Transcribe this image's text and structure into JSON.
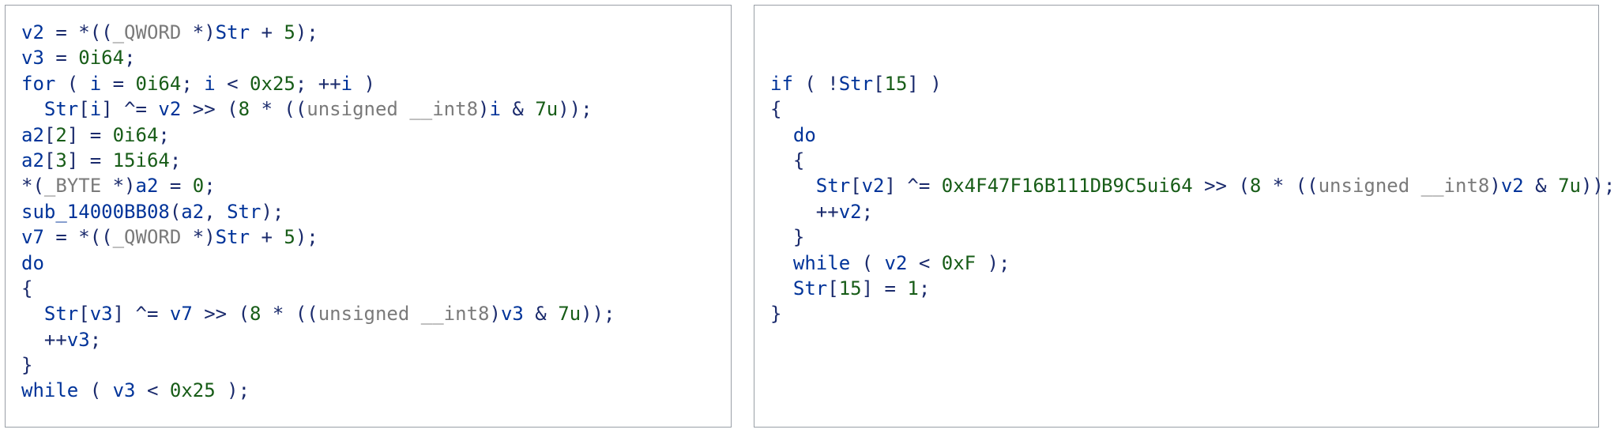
{
  "left": {
    "l1": {
      "a": "v2",
      "b": " = *((",
      "c": "_QWORD",
      "d": " *)",
      "e": "Str",
      "f": " + ",
      "g": "5",
      "h": ");"
    },
    "l2": {
      "a": "v3",
      "b": " = ",
      "c": "0i64",
      "d": ";"
    },
    "l3": {
      "a": "for",
      "b": " ( ",
      "c": "i",
      "d": " = ",
      "e": "0i64",
      "f": "; ",
      "g": "i",
      "h": " < ",
      "i": "0x25",
      "j": "; ++",
      "k": "i",
      "l": " )"
    },
    "l4": {
      "a": "  ",
      "b": "Str",
      "c": "[",
      "d": "i",
      "e": "] ^= ",
      "f": "v2",
      "g": " >> (",
      "h": "8",
      "i": " * ((",
      "j": "unsigned __int8",
      "k": ")",
      "l": "i",
      "m": " & ",
      "n": "7u",
      "o": "));"
    },
    "l5": {
      "a": "a2",
      "b": "[",
      "c": "2",
      "d": "] = ",
      "e": "0i64",
      "f": ";"
    },
    "l6": {
      "a": "a2",
      "b": "[",
      "c": "3",
      "d": "] = ",
      "e": "15i64",
      "f": ";"
    },
    "l7": {
      "a": "*(",
      "b": "_BYTE",
      "c": " *)",
      "d": "a2",
      "e": " = ",
      "f": "0",
      "g": ";"
    },
    "l8": {
      "a": "sub_14000BB08",
      "b": "(",
      "c": "a2",
      "d": ", ",
      "e": "Str",
      "f": ");"
    },
    "l9": {
      "a": "v7",
      "b": " = *((",
      "c": "_QWORD",
      "d": " *)",
      "e": "Str",
      "f": " + ",
      "g": "5",
      "h": ");"
    },
    "l10": {
      "a": "do"
    },
    "l11": {
      "a": "{"
    },
    "l12": {
      "a": "  ",
      "b": "Str",
      "c": "[",
      "d": "v3",
      "e": "] ^= ",
      "f": "v7",
      "g": " >> (",
      "h": "8",
      "i": " * ((",
      "j": "unsigned __int8",
      "k": ")",
      "l": "v3",
      "m": " & ",
      "n": "7u",
      "o": "));"
    },
    "l13": {
      "a": "  ++",
      "b": "v3",
      "c": ";"
    },
    "l14": {
      "a": "}"
    },
    "l15": {
      "a": "while",
      "b": " ( ",
      "c": "v3",
      "d": " < ",
      "e": "0x25",
      "f": " );"
    }
  },
  "right": {
    "l1": {
      "a": "if",
      "b": " ( !",
      "c": "Str",
      "d": "[",
      "e": "15",
      "f": "] )"
    },
    "l2": {
      "a": "{"
    },
    "l3": {
      "a": "  ",
      "b": "do"
    },
    "l4": {
      "a": "  {"
    },
    "l5": {
      "a": "    ",
      "b": "Str",
      "c": "[",
      "d": "v2",
      "e": "] ^= ",
      "f": "0x4F47F16B111DB9C5ui64",
      "g": " >> (",
      "h": "8",
      "i": " * ((",
      "j": "unsigned __int8",
      "k": ")",
      "l": "v2",
      "m": " & ",
      "n": "7u",
      "o": "));"
    },
    "l6": {
      "a": "    ++",
      "b": "v2",
      "c": ";"
    },
    "l7": {
      "a": "  }"
    },
    "l8": {
      "a": "  ",
      "b": "while",
      "c": " ( ",
      "d": "v2",
      "e": " < ",
      "f": "0xF",
      "g": " );"
    },
    "l9": {
      "a": "  ",
      "b": "Str",
      "c": "[",
      "d": "15",
      "e": "] = ",
      "f": "1",
      "g": ";"
    },
    "l10": {
      "a": "}"
    }
  }
}
